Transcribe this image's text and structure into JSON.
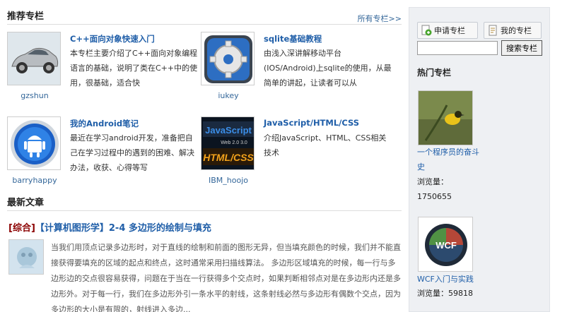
{
  "recommended": {
    "title": "推荐专栏",
    "more_link": "所有专栏>>",
    "cards": [
      {
        "title": "C++面向对象快速入门",
        "desc": "本专栏主要介绍了C++面向对象编程语言的基础，说明了类在C++中的使用，很基础，适合快",
        "author": "gzshun",
        "image": "car-icon"
      },
      {
        "title": "sqlite基础教程",
        "desc": "由浅入深讲解移动平台(IOS/Android)上sqlite的使用，从最简单的讲起，让读者可以从",
        "author": "iukey",
        "image": "gear-icon"
      },
      {
        "title": "我的Android笔记",
        "desc": "最近在学习android开发，准备把自己在学习过程中的遇到的困难、解决办法，收获、心得等写",
        "author": "barryhappy",
        "image": "android-icon"
      },
      {
        "title": "JavaScript/HTML/CSS",
        "desc": "介绍JavaScript、HTML、CSS相关技术",
        "author": "IBM_hoojo",
        "image": "javascript-book-icon"
      }
    ]
  },
  "latest": {
    "title": "最新文章",
    "article": {
      "category": "[综合]",
      "title": "【计算机图形学】2-4 多边形的绘制与填充",
      "body": "当我们用顶点记录多边形时，对于直线的绘制和前面的图形无异，但当填充颜色的时候，我们并不能直接获得要填充的区域的起点和终点，这时通常采用扫描线算法。        多边形区域填充的时候，每一行与多边形边的交点很容易获得，问题在于当在一行获得多个交点时，如果判断相邻点对是在多边形内还是多边形外。对于每一行，我们在多边形外引一条水平的射线，这条射线必然与多边形有偶数个交点，因为多边形的大小是有限的，射线进入多边..."
    }
  },
  "sidebar": {
    "apply_button": "申请专栏",
    "my_button": "我的专栏",
    "search_placeholder": "",
    "search_button": "搜索专栏",
    "hot_title": "热门专栏",
    "hot_items": [
      {
        "name": "一个程序员的奋斗史",
        "views_label": "浏览量：",
        "views": "1750655",
        "image": "bird-icon"
      },
      {
        "name": "WCF入门与实践",
        "views_label": "浏览量：",
        "views": "59818",
        "image": "wcf-logo-icon"
      }
    ]
  },
  "colors": {
    "link": "#1f5ea8",
    "category": "#8b0000",
    "sidebar_bg": "#eef0f3"
  }
}
